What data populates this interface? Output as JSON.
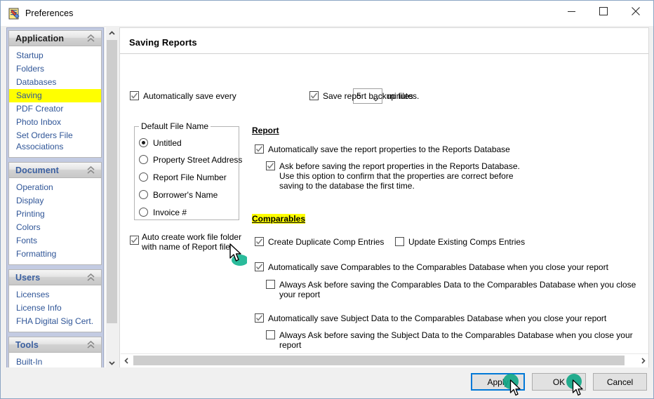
{
  "window": {
    "title": "Preferences",
    "icon": "preferences-document-icon",
    "minimize": "minimize-icon",
    "maximize": "maximize-icon",
    "close": "close-icon"
  },
  "sidebar": {
    "sections": [
      {
        "header": "Application",
        "style": "dark",
        "items": [
          {
            "label": "Startup",
            "selected": false
          },
          {
            "label": "Folders",
            "selected": false
          },
          {
            "label": "Databases",
            "selected": false
          },
          {
            "label": "Saving",
            "selected": true
          },
          {
            "label": "PDF Creator",
            "selected": false
          },
          {
            "label": "Photo Inbox",
            "selected": false
          },
          {
            "label": "Set Orders File\nAssociations",
            "selected": false
          }
        ]
      },
      {
        "header": "Document",
        "style": "blue",
        "items": [
          {
            "label": "Operation",
            "selected": false
          },
          {
            "label": "Display",
            "selected": false
          },
          {
            "label": "Printing",
            "selected": false
          },
          {
            "label": "Colors",
            "selected": false
          },
          {
            "label": "Fonts",
            "selected": false
          },
          {
            "label": "Formatting",
            "selected": false
          }
        ]
      },
      {
        "header": "Users",
        "style": "blue",
        "items": [
          {
            "label": "Licenses",
            "selected": false
          },
          {
            "label": "License Info",
            "selected": false
          },
          {
            "label": "FHA Digital Sig Cert.",
            "selected": false
          }
        ]
      },
      {
        "header": "Tools",
        "style": "blue",
        "items": [
          {
            "label": "Built-In",
            "selected": false
          }
        ]
      }
    ],
    "scroll_up": "scroll-up-icon",
    "scroll_down": "scroll-down-icon"
  },
  "main": {
    "page_title": "Saving Reports",
    "autosave": {
      "label": "Automatically save every",
      "checked": true,
      "interval_value": "5",
      "unit_label": "minutes."
    },
    "backup": {
      "label": "Save report backup files",
      "checked": true
    },
    "default_file_name": {
      "group_label": "Default File Name",
      "options": [
        {
          "label": "Untitled",
          "selected": true
        },
        {
          "label": "Property Street Address",
          "selected": false
        },
        {
          "label": "Report File Number",
          "selected": false
        },
        {
          "label": "Borrower's Name",
          "selected": false
        },
        {
          "label": "Invoice #",
          "selected": false
        }
      ]
    },
    "auto_workfolder": {
      "label": "Auto create work file folder\nwith name of Report file",
      "checked": true
    },
    "report_section": {
      "heading": "Report",
      "highlight": false,
      "items": [
        {
          "label": "Automatically save the report properties to the Reports Database",
          "checked": true,
          "indent": 0
        },
        {
          "label": "Ask before saving the report properties in the Reports Database.\nUse this option to confirm that the properties are correct before\nsaving to the database the first time.",
          "checked": true,
          "indent": 1
        }
      ]
    },
    "comparables_section": {
      "heading": "Comparables",
      "highlight": true,
      "items": [
        {
          "label": "Create Duplicate Comp Entries",
          "checked": true,
          "indent": 0
        },
        {
          "label": "Update Existing Comps Entries",
          "checked": false,
          "indent": 0
        },
        {
          "label": "Automatically save Comparables to the Comparables Database when you close your report",
          "checked": true,
          "indent": 0
        },
        {
          "label": "Always Ask before saving the Comparables Data to the Comparables Database when you close your report",
          "checked": false,
          "indent": 1
        },
        {
          "label": "Automatically save Subject Data to the Comparables Database when you close your report",
          "checked": true,
          "indent": 0
        },
        {
          "label": "Always Ask before saving the Subject Data to the Comparables Database when you close your report",
          "checked": false,
          "indent": 1
        }
      ]
    },
    "hscroll_left": "scroll-left-icon",
    "hscroll_right": "scroll-right-icon"
  },
  "footer": {
    "apply_label": "Apply",
    "ok_label": "OK",
    "cancel_label": "Cancel"
  },
  "colors": {
    "highlight_yellow": "#ffff00",
    "nav_link_blue": "#2f5597",
    "nav_pane_bg": "#c3cbe2",
    "focus_blue": "#0078d7",
    "click_marker_teal": "#12a787"
  }
}
